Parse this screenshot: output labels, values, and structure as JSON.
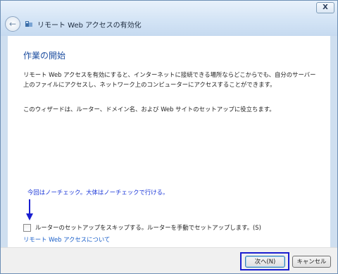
{
  "window": {
    "title": "リモート Web アクセスの有効化",
    "close_label": "X"
  },
  "icons": {
    "back": "back-arrow-icon",
    "app": "remote-web-access-icon",
    "close": "close-icon",
    "annotation_arrow": "down-arrow-icon"
  },
  "content": {
    "heading": "作業の開始",
    "paragraph1": "リモート Web アクセスを有効にすると、インターネットに接続できる場所ならどこからでも、自分のサーバー上のファイルにアクセスし、ネットワーク上のコンピューターにアクセスすることができます。",
    "paragraph2": "このウィザードは、ルーター、ドメイン名、および Web サイトのセットアップに役立ちます。",
    "annotation": "今回はノーチェック。大体はノーチェックで行ける。",
    "checkbox_label": "ルーターのセットアップをスキップする。ルーターを手動でセットアップします。(S)",
    "checkbox_checked": false,
    "link": "リモート Web アクセスについて"
  },
  "footer": {
    "next_label": "次へ(N)",
    "cancel_label": "キャンセル"
  },
  "colors": {
    "heading": "#1d4ea0",
    "annotation": "#1a36d8",
    "link": "#1a5fc9",
    "highlight": "#1a1ed0"
  }
}
